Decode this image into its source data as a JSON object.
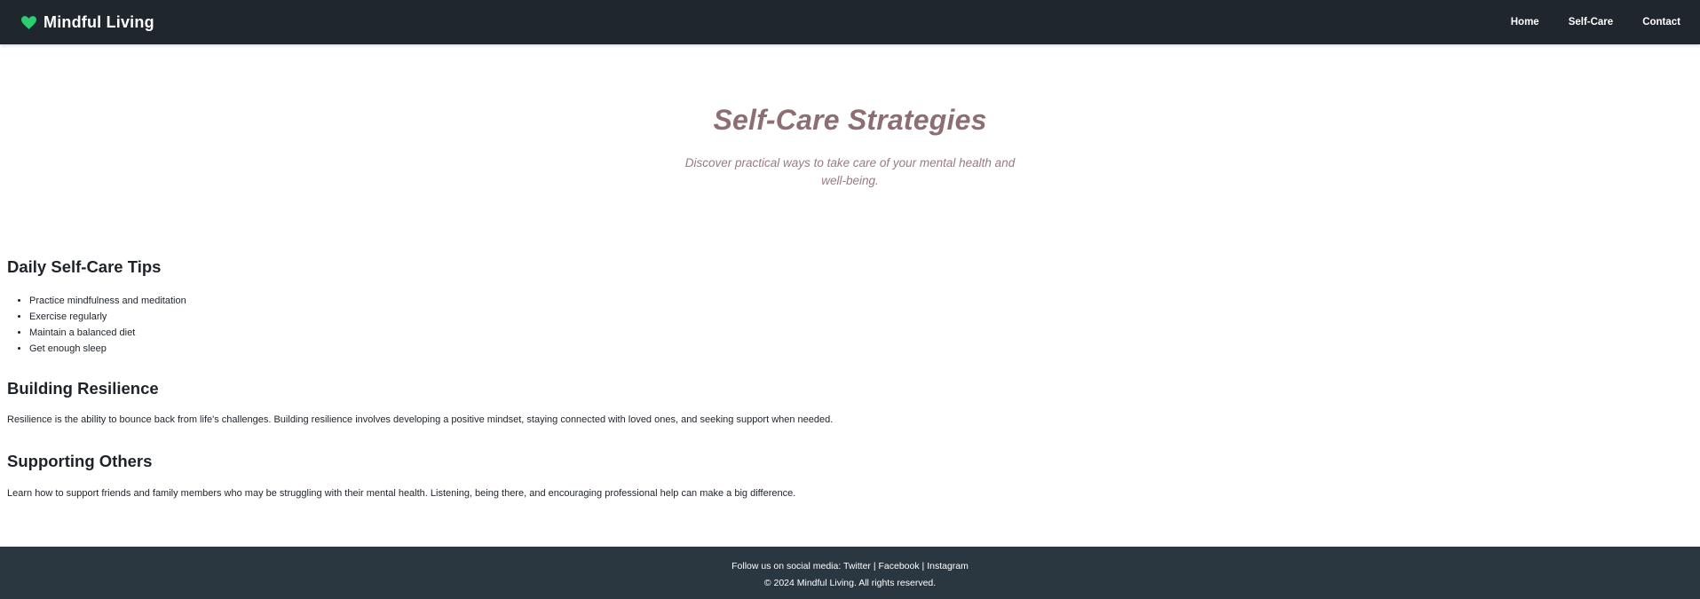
{
  "header": {
    "brand": "Mindful Living",
    "nav": [
      {
        "label": "Home"
      },
      {
        "label": "Self-Care"
      },
      {
        "label": "Contact"
      }
    ]
  },
  "hero": {
    "title": "Self-Care Strategies",
    "subtitle": "Discover practical ways to take care of your mental health and well-being."
  },
  "sections": {
    "tips": {
      "heading": "Daily Self-Care Tips",
      "items": [
        "Practice mindfulness and meditation",
        "Exercise regularly",
        "Maintain a balanced diet",
        "Get enough sleep"
      ]
    },
    "resilience": {
      "heading": "Building Resilience",
      "text": "Resilience is the ability to bounce back from life's challenges. Building resilience involves developing a positive mindset, staying connected with loved ones, and seeking support when needed."
    },
    "supporting": {
      "heading": "Supporting Others",
      "text": "Learn how to support friends and family members who may be struggling with their mental health. Listening, being there, and encouraging professional help can make a big difference."
    }
  },
  "footer": {
    "follow_prefix": "Follow us on social media:",
    "social": [
      "Twitter",
      "Facebook",
      "Instagram"
    ],
    "separator": "|",
    "copyright": "© 2024 Mindful Living. All rights reserved."
  },
  "colors": {
    "navbar_bg": "#1f262e",
    "footer_bg": "#2a3640",
    "hero_title": "#8d6e72",
    "heart_icon": "#2ecc71"
  },
  "icons": {
    "brand": "heart-icon"
  }
}
